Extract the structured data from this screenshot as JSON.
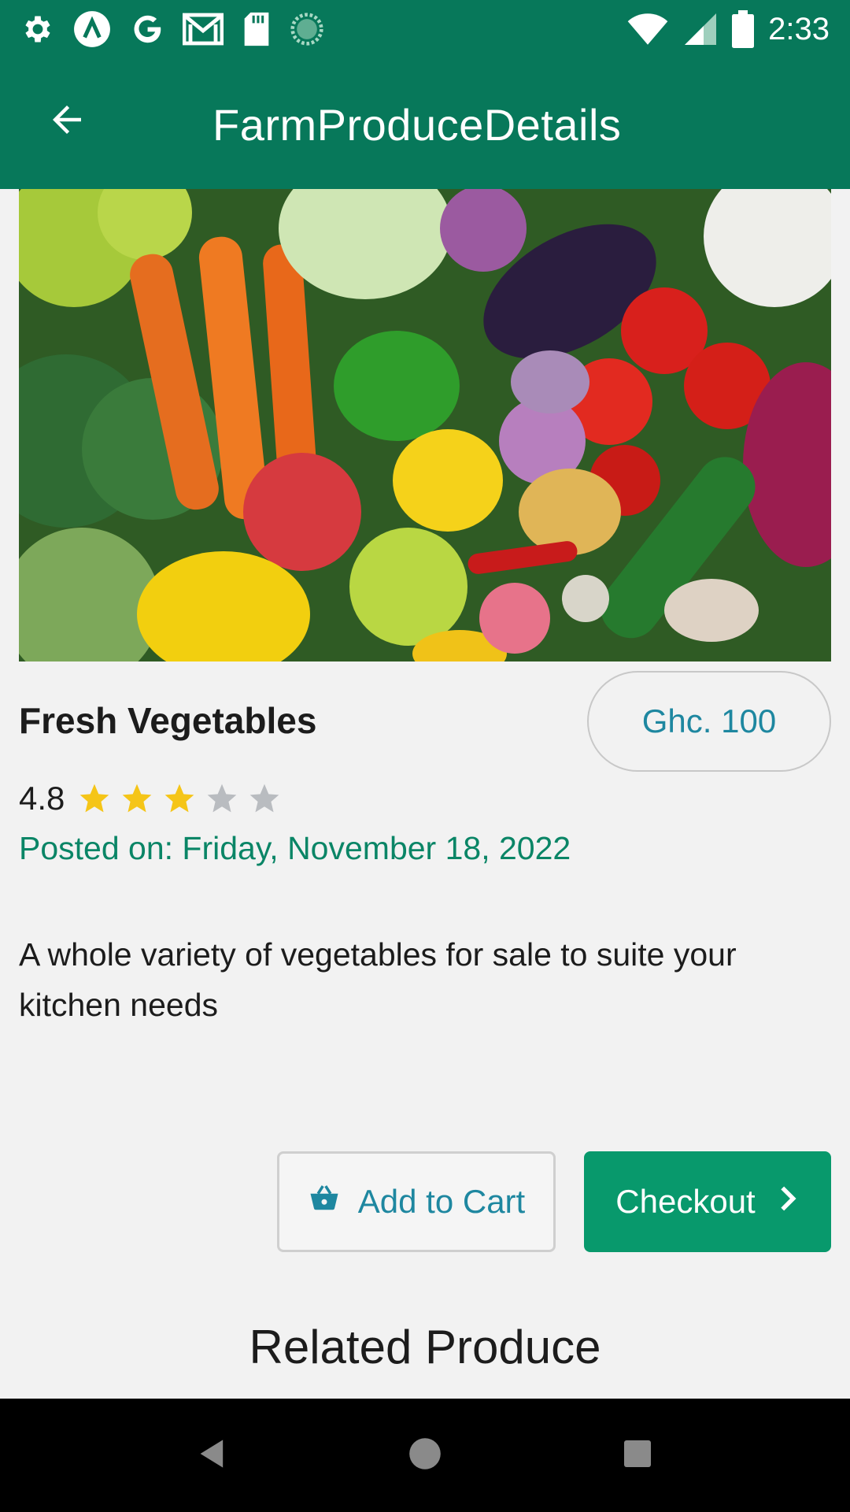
{
  "status_bar": {
    "time": "2:33",
    "icons": [
      "settings-gear-icon",
      "app-notification-icon",
      "google-icon",
      "gmail-icon",
      "sd-card-icon",
      "sync-icon",
      "wifi-icon",
      "signal-icon",
      "battery-icon"
    ]
  },
  "app_bar": {
    "title": "FarmProduceDetails",
    "back_icon": "arrow-left-icon"
  },
  "product": {
    "image_alt": "vegetables-photo",
    "name": "Fresh Vegetables",
    "price": "Ghc. 100",
    "rating": "4.8",
    "stars_filled": 3,
    "stars_total": 5,
    "posted": "Posted on: Friday, November 18, 2022",
    "description": "A whole variety of vegetables for sale to suite your kitchen needs"
  },
  "actions": {
    "add_to_cart": "Add to Cart",
    "checkout": "Checkout"
  },
  "related": {
    "title": "Related Produce"
  },
  "colors": {
    "primary": "#07785a",
    "accent": "#08996c",
    "link": "#1e87a0",
    "star_filled": "#f5c518",
    "star_empty": "#b9bcc0"
  }
}
